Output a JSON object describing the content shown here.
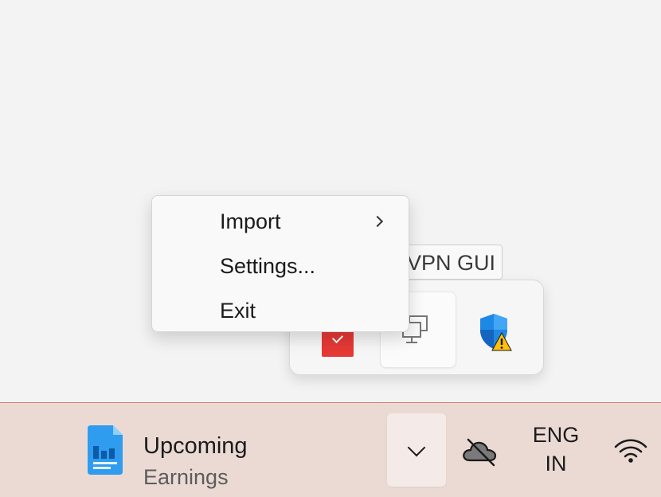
{
  "context_menu": {
    "items": [
      {
        "label": "Import",
        "has_submenu": true,
        "icon": "chevron-right-icon"
      },
      {
        "label": "Settings..."
      },
      {
        "label": "Exit"
      }
    ]
  },
  "tooltip": {
    "text": "VPN GUI"
  },
  "tray_flyout": {
    "icons": [
      {
        "name": "red-app-icon"
      },
      {
        "name": "network-computer-icon"
      },
      {
        "name": "windows-security-warning-icon"
      }
    ]
  },
  "taskbar": {
    "widget": {
      "title": "Upcoming",
      "subtitle": "Earnings",
      "icon": "document-chart-icon"
    },
    "show_hidden_icon": "chevron-down-icon",
    "onedrive_icon": "cloud-offline-icon",
    "language": {
      "line1": "ENG",
      "line2": "IN"
    },
    "wifi_icon": "wifi-icon"
  },
  "colors": {
    "taskbar_bg": "#ebdad4",
    "taskbar_border": "#d97b6f",
    "desktop_bg": "#f3f3f3",
    "shield_blue": "#1e88e5",
    "warning_yellow": "#ffc107",
    "red_app": "#e53935"
  }
}
